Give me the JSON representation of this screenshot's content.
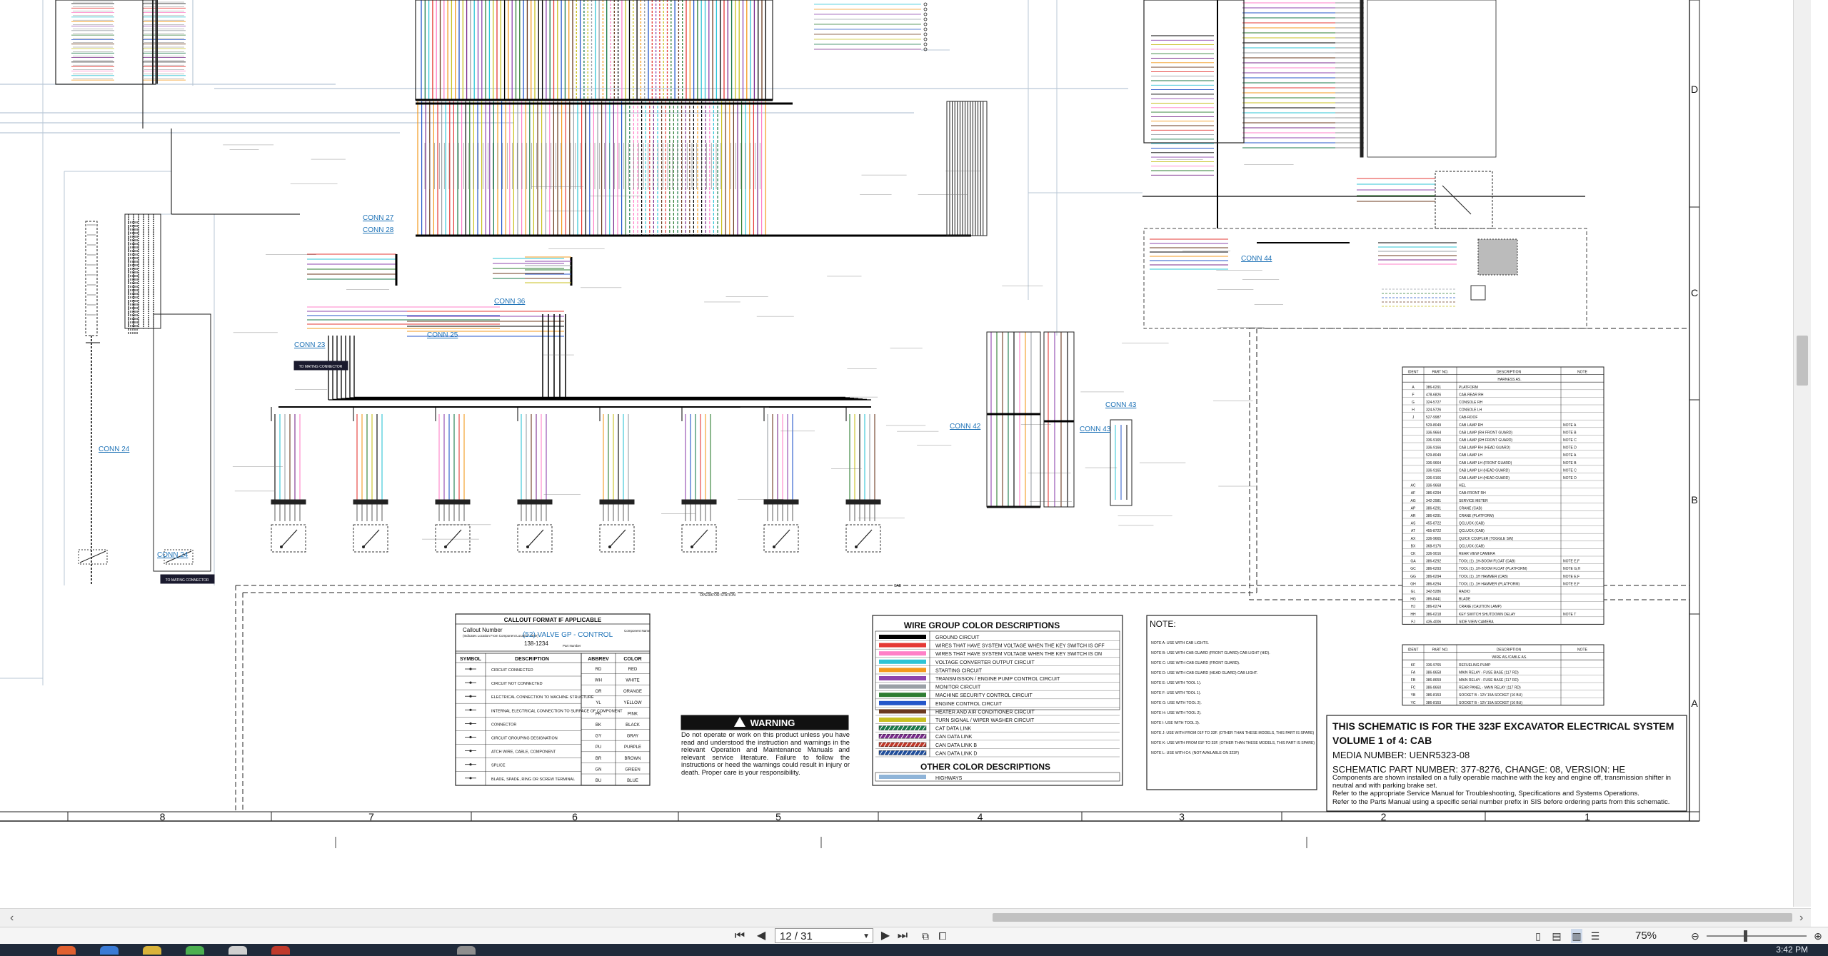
{
  "document": {
    "callout_format": {
      "title": "CALLOUT FORMAT IF APPLICABLE",
      "callout_number_label": "Callout Number",
      "callout_number_note": "(Indicates Location From Component Location Table)",
      "example_text": "(52) VALVE GP - CONTROL",
      "example_part": "138-1234",
      "component_name_label": "Component Name",
      "part_number_label": "Part Number",
      "symbol_header": "SYMBOL",
      "description_header": "DESCRIPTION",
      "symbol_rows": [
        "CIRCUIT CONNECTED",
        "CIRCUIT NOT CONNECTED",
        "ELECTRICAL CONNECTION TO MACHINE STRUCTURE",
        "INTERNAL ELECTRICAL CONNECTION TO SURFACE OF COMPONENT",
        "CONNECTOR",
        "CIRCUIT GROUPING DESIGNATION",
        "ATCH WIRE, CABLE, COMPONENT",
        "SPLICE",
        "BLADE, SPADE, RING OR SCREW TERMINAL"
      ],
      "abbrev_header": "ABBREV",
      "color_header": "COLOR",
      "color_rows": [
        {
          "abbrev": "RD",
          "color": "RED"
        },
        {
          "abbrev": "WH",
          "color": "WHITE"
        },
        {
          "abbrev": "OR",
          "color": "ORANGE"
        },
        {
          "abbrev": "YL",
          "color": "YELLOW"
        },
        {
          "abbrev": "PK",
          "color": "PINK"
        },
        {
          "abbrev": "BK",
          "color": "BLACK"
        },
        {
          "abbrev": "GY",
          "color": "GRAY"
        },
        {
          "abbrev": "PU",
          "color": "PURPLE"
        },
        {
          "abbrev": "BR",
          "color": "BROWN"
        },
        {
          "abbrev": "GN",
          "color": "GREEN"
        },
        {
          "abbrev": "BU",
          "color": "BLUE"
        }
      ]
    },
    "warning": {
      "title": "WARNING",
      "text": "Do not operate or work on this product unless you have read and understood the instruction and warnings in the relevant Operation and Maintenance Manuals and relevant service literature. Failure to follow the instructions or heed the warnings could result in injury or death. Proper care is your responsibility."
    },
    "wire_groups": {
      "title": "WIRE GROUP COLOR DESCRIPTIONS",
      "rows": [
        {
          "label": "GROUND CIRCUIT",
          "color": "#000000",
          "style": "solid"
        },
        {
          "label": "WIRES THAT HAVE SYSTEM VOLTAGE WHEN THE KEY SWITCH IS OFF",
          "color": "#e53935",
          "style": "solid"
        },
        {
          "label": "WIRES THAT HAVE SYSTEM VOLTAGE WHEN THE KEY SWITCH IS ON",
          "color": "#ff80c8",
          "style": "solid"
        },
        {
          "label": "VOLTAGE CONVERTER OUTPUT CIRCUIT",
          "color": "#2ec4d6",
          "style": "solid"
        },
        {
          "label": "STARTING CIRCUIT",
          "color": "#f39a1e",
          "style": "solid"
        },
        {
          "label": "TRANSMISSION / ENGINE PUMP CONTROL CIRCUIT",
          "color": "#8e44ad",
          "style": "solid"
        },
        {
          "label": "MONITOR CIRCUIT",
          "color": "#9aa0a6",
          "style": "solid"
        },
        {
          "label": "MACHINE SECURITY CONTROL CIRCUIT",
          "color": "#2e7d32",
          "style": "solid"
        },
        {
          "label": "ENGINE CONTROL CIRCUIT",
          "color": "#2456c9",
          "style": "solid"
        },
        {
          "label": "HEATER AND AIR CONDITIONER CIRCUIT",
          "color": "#6b3a1e",
          "style": "solid"
        },
        {
          "label": "TURN SIGNAL / WIPER WASHER CIRCUIT",
          "color": "#c8c020",
          "style": "solid"
        },
        {
          "label": "CAT DATA LINK",
          "color": "#1a7a4a",
          "style": "hatched"
        },
        {
          "label": "CAN DATA LINK",
          "color": "#7a2b8c",
          "style": "hatched"
        },
        {
          "label": "CAN DATA LINK B",
          "color": "#c0392b",
          "style": "hatched"
        },
        {
          "label": "CAN DATA LINK D",
          "color": "#1f4e9c",
          "style": "hatched"
        }
      ],
      "other_title": "OTHER COLOR DESCRIPTIONS",
      "other_rows": [
        {
          "label": "HIGHWAYS",
          "color": "#8fb4d8"
        }
      ]
    },
    "notes": {
      "title": "NOTE:",
      "rows": [
        "NOTE A: USE WITH CAB LIGHTS.",
        "NOTE B: USE WITH CAB GUARD (FRONT GUARD) CAB LIGHT (HID).",
        "NOTE C: USE WITH CAB GUARD (FRONT GUARD).",
        "NOTE D: USE WITH CAB GUARD (HEAD GUARD) CAB LIGHT.",
        "NOTE E: USE WITH TOOL 1).",
        "NOTE F: USE WITH TOOL 1).",
        "NOTE G: USE WITH TOOL 2).",
        "NOTE H: USE WITH TOOL 2).",
        "NOTE I: USE WITH TOOL 3).",
        "NOTE J: USE WITH FROM 01F TO 33F. (OTHER THAN THESE MODELS, THIS PART IS SPARE)",
        "NOTE K: USE WITH FROM 01F TO 33F. (OTHER THAN THESE MODELS, THIS PART IS SPARE)",
        "NOTE L: USE WITH C4. (NOT AVAILABLE ON 323F)"
      ]
    },
    "title_block": {
      "line1": "THIS SCHEMATIC IS FOR THE 323F EXCAVATOR ELECTRICAL SYSTEM",
      "line2": "VOLUME 1 of 4: CAB",
      "media": "MEDIA NUMBER: UENR5323-08",
      "part": "SCHEMATIC PART NUMBER: 377-8276, CHANGE: 08, VERSION: HE",
      "desc1": "Components are shown installed on a fully operable machine with the key and engine off, transmission shifter in neutral and with parking brake set.",
      "desc2": "Refer to the appropriate Service Manual for Troubleshooting, Specifications and Systems Operations.",
      "desc3": "Refer to the Parts Manual using a specific serial number prefix in SIS before ordering parts from this schematic."
    },
    "harness_table": {
      "headers": [
        "IDENT",
        "PART NO.",
        "DESCRIPTION",
        "NOTE"
      ],
      "group_title": "HARNESS AS.",
      "rows": [
        [
          "A",
          "386-6291",
          "PLATFORM",
          ""
        ],
        [
          "F",
          "478-6826",
          "CAB-REAR RH",
          ""
        ],
        [
          "G",
          "324-5727",
          "CONSOLE RH",
          ""
        ],
        [
          "H",
          "324-5726",
          "CONSOLE LH",
          ""
        ],
        [
          "J",
          "527-9987",
          "CAB-ROOF",
          ""
        ],
        [
          "",
          "529-8049",
          "CAB LAMP RH",
          "NOTE A"
        ],
        [
          "",
          "336-9664",
          "CAB LAMP (RH FRONT GUARD)",
          "NOTE B"
        ],
        [
          "",
          "336-9165",
          "CAB LAMP (RH FRONT GUARD)",
          "NOTE C"
        ],
        [
          "",
          "336-9166",
          "CAB LAMP RH (HEAD GUARD)",
          "NOTE D"
        ],
        [
          "",
          "529-8049",
          "CAB LAMP LH",
          "NOTE A"
        ],
        [
          "",
          "336-9664",
          "CAB LAMP LH (FRONT GUARD)",
          "NOTE B"
        ],
        [
          "",
          "336-9165",
          "CAB LAMP LH (HEAD GUARD)",
          "NOTE C"
        ],
        [
          "",
          "336-9166",
          "CAB LAMP LH (HEAD GUARD)",
          "NOTE D"
        ],
        [
          "AC",
          "336-9668",
          "HEL",
          ""
        ],
        [
          "AF",
          "386-6294",
          "CAB-FRONT RH",
          ""
        ],
        [
          "AG",
          "342-2981",
          "SERVICE METER",
          ""
        ],
        [
          "AP",
          "386-6291",
          "CRANE (CAB)",
          ""
        ],
        [
          "AR",
          "386-6291",
          "CRANE (PLATFORM)",
          ""
        ],
        [
          "AS",
          "455-8722",
          "QCLUCK (CAB)",
          ""
        ],
        [
          "AT",
          "455-8722",
          "QCLUCK (CAB)",
          ""
        ],
        [
          "AX",
          "336-9665",
          "QUICK COUPLER (TOGGLE SW)",
          ""
        ],
        [
          "BX",
          "368-9176",
          "QCLUCK (CAB)",
          ""
        ],
        [
          "CK",
          "336-9016",
          "REAR VIEW CAMERA",
          ""
        ],
        [
          "GA",
          "386-6292",
          "TOOL (1) ,1H-BOOM FLOAT (CAB)",
          "NOTE E,F"
        ],
        [
          "GC",
          "386-6293",
          "TOOL (1) ,1H-BOOM FLOAT (PLATFORM)",
          "NOTE G,H"
        ],
        [
          "GG",
          "386-6294",
          "TOOL (1) ,1H HAMMER (CAB)",
          "NOTE E,F"
        ],
        [
          "GH",
          "386-6294",
          "TOOL (1) ,1H HAMMER (PLATFORM)",
          "NOTE E,F"
        ],
        [
          "GL",
          "342-5286",
          "RADIO",
          ""
        ],
        [
          "HG",
          "386-8441",
          "BLADE",
          ""
        ],
        [
          "HJ",
          "386-6274",
          "CRANE (CAUTION LAMP)",
          ""
        ],
        [
          "HH",
          "386-6218",
          "KEY SWITCH SHUTDOWN DELAY",
          "NOTE T"
        ],
        [
          "FJ",
          "435-4006",
          "SIDE VIEW CAMERA",
          ""
        ]
      ]
    },
    "cable_table": {
      "headers": [
        "IDENT",
        "PART NO.",
        "DESCRIPTION",
        "NOTE"
      ],
      "group_title": "WIRE AS./CABLE AS.",
      "rows": [
        [
          "KF",
          "336-9765",
          "REFUELING PUMP",
          ""
        ],
        [
          "FA",
          "386-8658",
          "MAIN RELAY - FUSE BASE (117 RD)",
          ""
        ],
        [
          "FB",
          "386-8659",
          "MAIN RELAY - FUSE BASE (117 RD)",
          ""
        ],
        [
          "FC",
          "386-8660",
          "REAR PANEL - MAIN RELAY (117 RD)",
          ""
        ],
        [
          "YB",
          "386-8153",
          "SOCKET B - 12V 15A SOCKET (16 BU)",
          ""
        ],
        [
          "YC",
          "386-8153",
          "SOCKET B - 12V 15A SOCKET (16 BU)",
          ""
        ]
      ]
    },
    "zone_numbers": [
      "8",
      "7",
      "6",
      "5",
      "4",
      "3",
      "2",
      "1"
    ],
    "zone_letters": [
      "D",
      "C",
      "B",
      "A"
    ],
    "connectors": [
      "CONN 27",
      "CONN 28",
      "CONN 36",
      "CONN 23",
      "CONN 25",
      "CONN 24",
      "CONN 24",
      "CONN 42",
      "CONN 43",
      "CONN 43",
      "CONN 44"
    ],
    "to_mating": "TO MATING CONNECTOR",
    "operator_station": "OPERATOR STATION",
    "cab_label": "CAB"
  },
  "viewer": {
    "page_value": "12 / 31",
    "zoom": "75%",
    "clock": "3:42 PM"
  }
}
